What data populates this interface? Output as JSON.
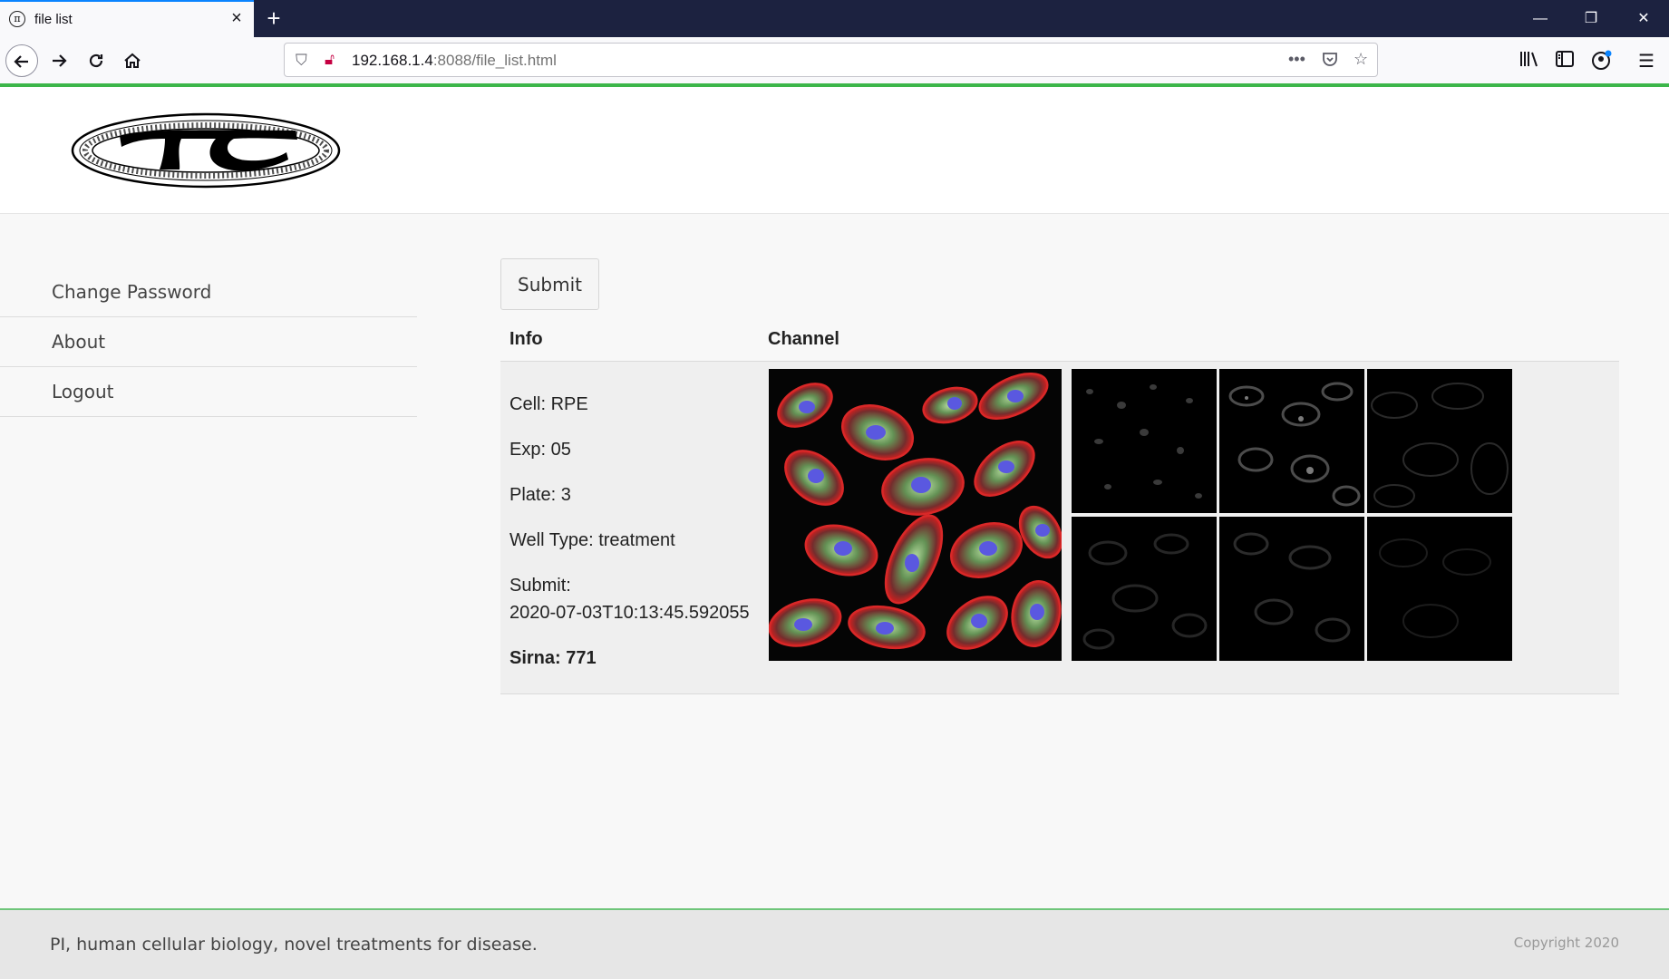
{
  "browser": {
    "tab_title": "file list",
    "tab_favicon": "π",
    "new_tab": "+",
    "url_host": "192.168.1.4",
    "url_rest": ":8088/file_list.html",
    "window_controls": [
      "—",
      "❐",
      "✕"
    ]
  },
  "header": {
    "logo_icon": "pi-logo-icon"
  },
  "sidebar": {
    "items": [
      {
        "label": "Change Password"
      },
      {
        "label": "About"
      },
      {
        "label": "Logout"
      }
    ]
  },
  "main": {
    "submit_label": "Submit",
    "columns": [
      "Info",
      "Channel"
    ],
    "row": {
      "cell": "Cell: RPE",
      "exp": "Exp: 05",
      "plate": "Plate: 3",
      "well_type": "Well Type: treatment",
      "submit_label": "Submit:",
      "submit_time": "2020-07-03T10:13:45.592055",
      "sirna": "Sirna: 771"
    }
  },
  "footer": {
    "tagline": "PI, human cellular biology, novel treatments for disease.",
    "copyright": "Copyright 2020"
  },
  "colors": {
    "accent_green": "#3cb64a",
    "tab_bar": "#1c2240"
  }
}
